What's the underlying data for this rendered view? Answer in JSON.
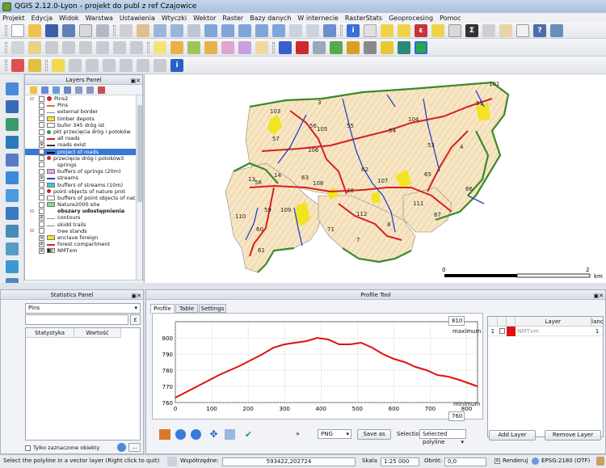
{
  "window": {
    "title": "QGIS 2.12.0-Lyon - projekt do publ z ref Czajowice"
  },
  "menu": [
    "Projekt",
    "Edycja",
    "Widok",
    "Warstwa",
    "Ustawienia",
    "Wtyczki",
    "Wektor",
    "Raster",
    "Bazy danych",
    "W internecie",
    "RasterStats",
    "Geoprocesing",
    "Pomoc"
  ],
  "layers_panel": {
    "title": "Layers Panel",
    "items": [
      {
        "label": "Pins2",
        "checked": false,
        "symbol": "pin",
        "expanded": true
      },
      {
        "label": "Pins",
        "checked": false,
        "symbol": "arrow"
      },
      {
        "label": "external border",
        "checked": false,
        "symbol": "line-gray"
      },
      {
        "label": "timber depots",
        "checked": false,
        "symbol": "yellow-square"
      },
      {
        "label": "bufor 345 dróg ist",
        "checked": false,
        "symbol": "white-square"
      },
      {
        "label": "pkt przecięcia dróg i potoków",
        "checked": false,
        "symbol": "green-dot"
      },
      {
        "label": "all roads",
        "checked": false,
        "symbol": "line-red"
      },
      {
        "label": "roads exist",
        "checked": true,
        "symbol": "line-dark"
      },
      {
        "label": "project of roads",
        "checked": true,
        "symbol": "line-black",
        "selected": true
      },
      {
        "label": "przecięcie dróg i potoków3",
        "checked": false,
        "symbol": "red-dot"
      },
      {
        "label": "springs",
        "checked": false,
        "symbol": "none"
      },
      {
        "label": "buffers of springs (20m)",
        "checked": false,
        "symbol": "pink-square"
      },
      {
        "label": "streams",
        "checked": true,
        "symbol": "line-blue"
      },
      {
        "label": "buffers of streams (10m)",
        "checked": false,
        "symbol": "cyan-square"
      },
      {
        "label": "point objects of nature prot",
        "checked": false,
        "symbol": "red-dot"
      },
      {
        "label": "buffers of point objects of nat...",
        "checked": false,
        "symbol": "white-square"
      },
      {
        "label": "Nature2000 site",
        "checked": false,
        "symbol": "green-square"
      },
      {
        "label": "obszary udostępnienia",
        "checked": false,
        "symbol": "none",
        "bold": true,
        "expanded": true
      },
      {
        "label": "contours",
        "checked": true,
        "symbol": "line-brown"
      },
      {
        "label": "skidd trails",
        "checked": false,
        "symbol": "line-gray"
      },
      {
        "label": "tree stands",
        "checked": false,
        "symbol": "none",
        "expanded": true
      },
      {
        "label": "enclave foreign",
        "checked": true,
        "symbol": "yellow-square"
      },
      {
        "label": "forest compartment",
        "checked": true,
        "symbol": "line-red"
      },
      {
        "label": "NMTxm",
        "checked": true,
        "symbol": "raster"
      }
    ]
  },
  "map": {
    "compartment_labels": [
      "103",
      "3",
      "105",
      "101",
      "51",
      "57",
      "56",
      "55",
      "54",
      "104",
      "53",
      "106",
      "4",
      "62",
      "63",
      "65",
      "13",
      "14",
      "108",
      "10",
      "107",
      "66",
      "58",
      "59",
      "109",
      "112",
      "111",
      "67",
      "110",
      "60",
      "71",
      "7",
      "8",
      "61"
    ],
    "scale_bar": {
      "start": "0",
      "end": "2",
      "unit": "km"
    },
    "colors": {
      "parcel_fill": "#f7e6c4",
      "contour": "#d9a86a",
      "border": "#3a8a2a",
      "road": "#d62020",
      "stream": "#2440c8",
      "enclave": "#f2e422"
    }
  },
  "stats_panel": {
    "title": "Statistics Panel",
    "layer_combo": "Pins",
    "field_combo": "",
    "columns": [
      "Statystyka",
      "Wartość"
    ],
    "selected_only_label": "Tylko zaznaczone obiekty"
  },
  "profile_tool": {
    "title": "Profile Tool",
    "tabs": [
      "Profile",
      "Table",
      "Settings"
    ],
    "chart_data": {
      "type": "line",
      "x": [
        0,
        60,
        120,
        180,
        240,
        270,
        300,
        330,
        360,
        390,
        420,
        450,
        480,
        510,
        540,
        570,
        600,
        630,
        660,
        690,
        720,
        750,
        780,
        830
      ],
      "y": [
        763,
        770,
        777,
        783,
        790,
        794,
        796,
        797,
        798,
        800,
        799,
        796,
        796,
        797,
        794,
        790,
        787,
        785,
        782,
        780,
        777,
        776,
        774,
        770
      ],
      "xlim": [
        0,
        830
      ],
      "ylim": [
        760,
        810
      ],
      "x_ticks": [
        "0",
        "100",
        "200",
        "300",
        "400",
        "500",
        "600",
        "700",
        "800"
      ],
      "y_ticks": [
        "760",
        "770",
        "780",
        "790",
        "800"
      ],
      "series_color": "#e01010",
      "grid": true
    },
    "max_value": "810",
    "max_label": "maximum",
    "min_value": "760",
    "min_label": "minimum",
    "format": "PNG",
    "save_label": "Save as",
    "selection_label": "Selection",
    "selection_value": "Selected polyline",
    "layer_table": {
      "columns": [
        "",
        "",
        "",
        "Layer",
        "lanc"
      ],
      "rows": [
        {
          "n": "1",
          "layer": "NMTxm",
          "band": "1",
          "color": "#e01010"
        }
      ]
    },
    "add_layer": "Add Layer",
    "remove_layer": "Remove Layer"
  },
  "statusbar": {
    "message": "Select the polyline in a vector layer (Right click to quit)",
    "coord_label": "Współrzędne:",
    "coord_value": "593422,202724",
    "scale_label": "Skala",
    "scale_value": "1:25 000",
    "rotation_label": "Obrót:",
    "rotation_value": "0,0",
    "render_label": "Renderuj",
    "crs": "EPSG:2180 (OTF)"
  }
}
